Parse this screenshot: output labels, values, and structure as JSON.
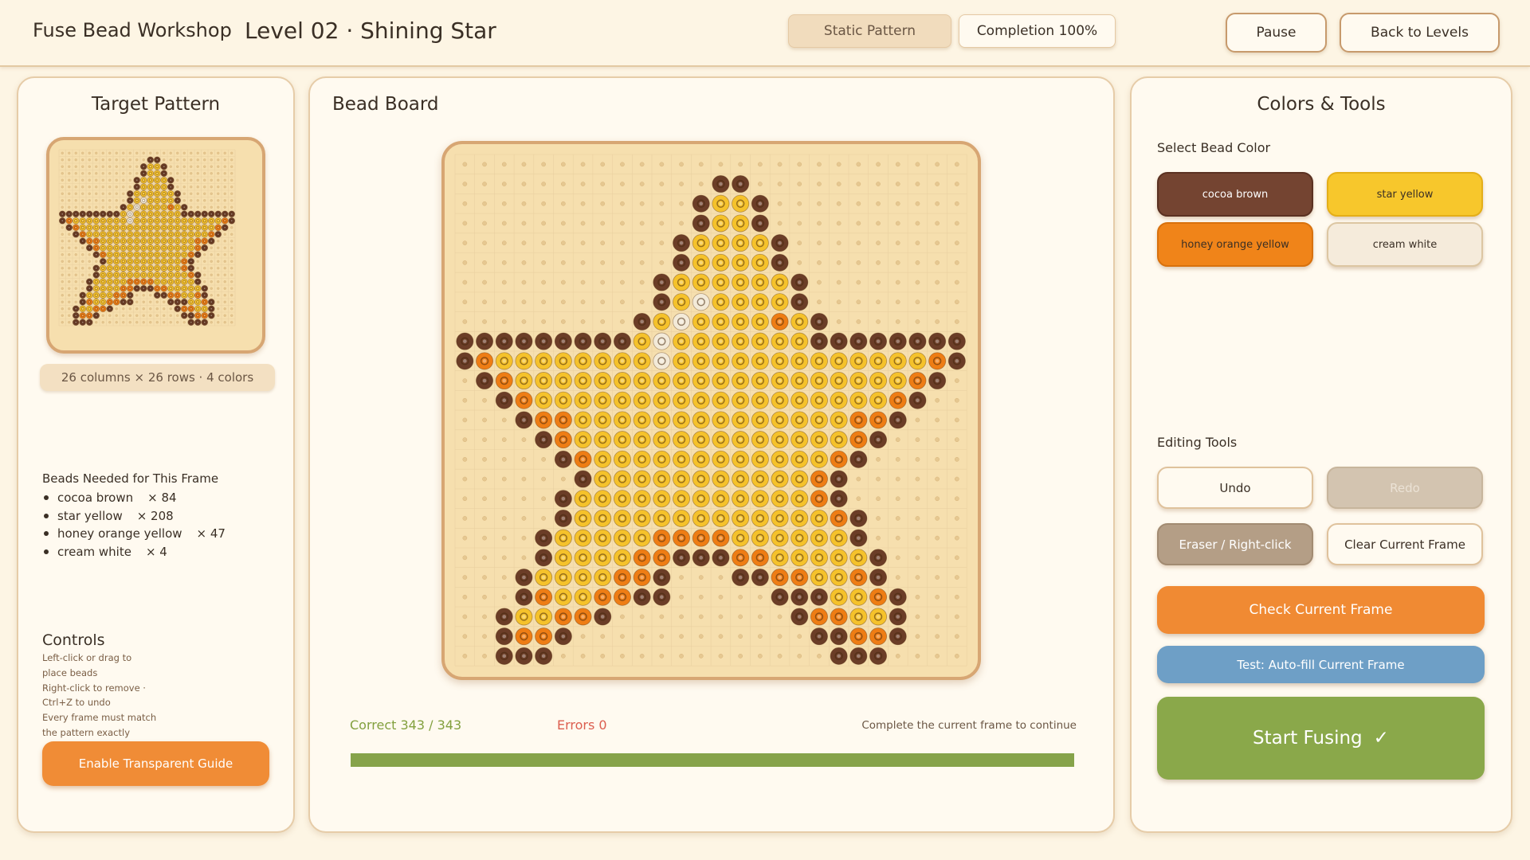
{
  "header": {
    "app_title": "Fuse Bead Workshop",
    "level_title": "Level 02 · Shining Star",
    "static_pattern": "Static Pattern",
    "completion": "Completion 100%",
    "pause": "Pause",
    "back": "Back to Levels"
  },
  "target": {
    "title": "Target Pattern",
    "size_label": "26 columns × 26 rows · 4 colors",
    "beads_title": "Beads Needed for This Frame",
    "beads": [
      {
        "name": "cocoa brown",
        "count": "× 84"
      },
      {
        "name": "star yellow",
        "count": "× 208"
      },
      {
        "name": "honey orange yellow",
        "count": "× 47"
      },
      {
        "name": "cream white",
        "count": "× 4"
      }
    ],
    "controls_title": "Controls",
    "controls_lines": [
      "Left-click or drag to",
      "place beads",
      "Right-click to remove ·",
      "Ctrl+Z to undo",
      "Every frame must match",
      "the pattern exactly"
    ],
    "guide_button": "Enable Transparent Guide"
  },
  "board": {
    "title": "Bead Board",
    "correct": "Correct 343 / 343",
    "errors": "Errors 0",
    "hint": "Complete the current frame to continue",
    "progress": 1.0
  },
  "tools": {
    "title": "Colors & Tools",
    "select_label": "Select Bead Color",
    "colors": [
      {
        "label": "cocoa brown",
        "color": "#744431"
      },
      {
        "label": "star yellow",
        "color": "#f7c72c"
      },
      {
        "label": "honey orange yellow",
        "color": "#f08419"
      },
      {
        "label": "cream white",
        "color": "#f5ebdb"
      }
    ],
    "editing_label": "Editing Tools",
    "undo": "Undo",
    "redo": "Redo",
    "eraser": "Eraser / Right-click",
    "clear": "Clear Current Frame",
    "check": "Check Current Frame",
    "autofill": "Test: Auto-fill Current Frame",
    "start": "Start Fusing",
    "start_icon": "✓"
  },
  "pattern": {
    "cols": 26,
    "rows": 26,
    "legend": {
      "B": "#6b3d27",
      "Y": "#f5c22b",
      "O": "#ee7d14",
      "W": "#f3ead8"
    },
    "grid": [
      "..........................",
      ".............BB...........",
      "............BYYB..........",
      "............BYYB..........",
      "...........BYYYYB.........",
      "...........BYYYYB.........",
      "..........BYYYYYYB........",
      "..........BYWYYYYB........",
      ".........BYWYYYYOYB.......",
      "BBBBBBBBBYWYYYYYYYBBBBBBBB",
      "BOYYYYYYYYWYYYYYYYYYYYYYOB",
      ".BOYYYYYYYYYYYYYYYYYYYYOB.",
      "..BOYYYYYYYYYYYYYYYYYYOB..",
      "...BOOYYYYYYYYYYYYYYOOB...",
      "....BOYYYYYYYYYYYYYYOB....",
      ".....BOYYYYYYYYYYYYOB.....",
      "......BYYYYYYYYYYYOB......",
      ".....BYYYYYYYYYYYYOB......",
      ".....BYYYYYYYYYYYYYOB.....",
      "....BYYYYYOOOOYYYYYYB.....",
      "....BYYYYOOBBBOOYYYYYB....",
      "...BYYYYOOB...BBOOYYOB....",
      "...BOYYOOBB.....BBBYYOB...",
      "..BYYOOB.........BOOYYB...",
      "..BOOB............BBOOB...",
      "..BBB..............BBB...."
    ]
  }
}
